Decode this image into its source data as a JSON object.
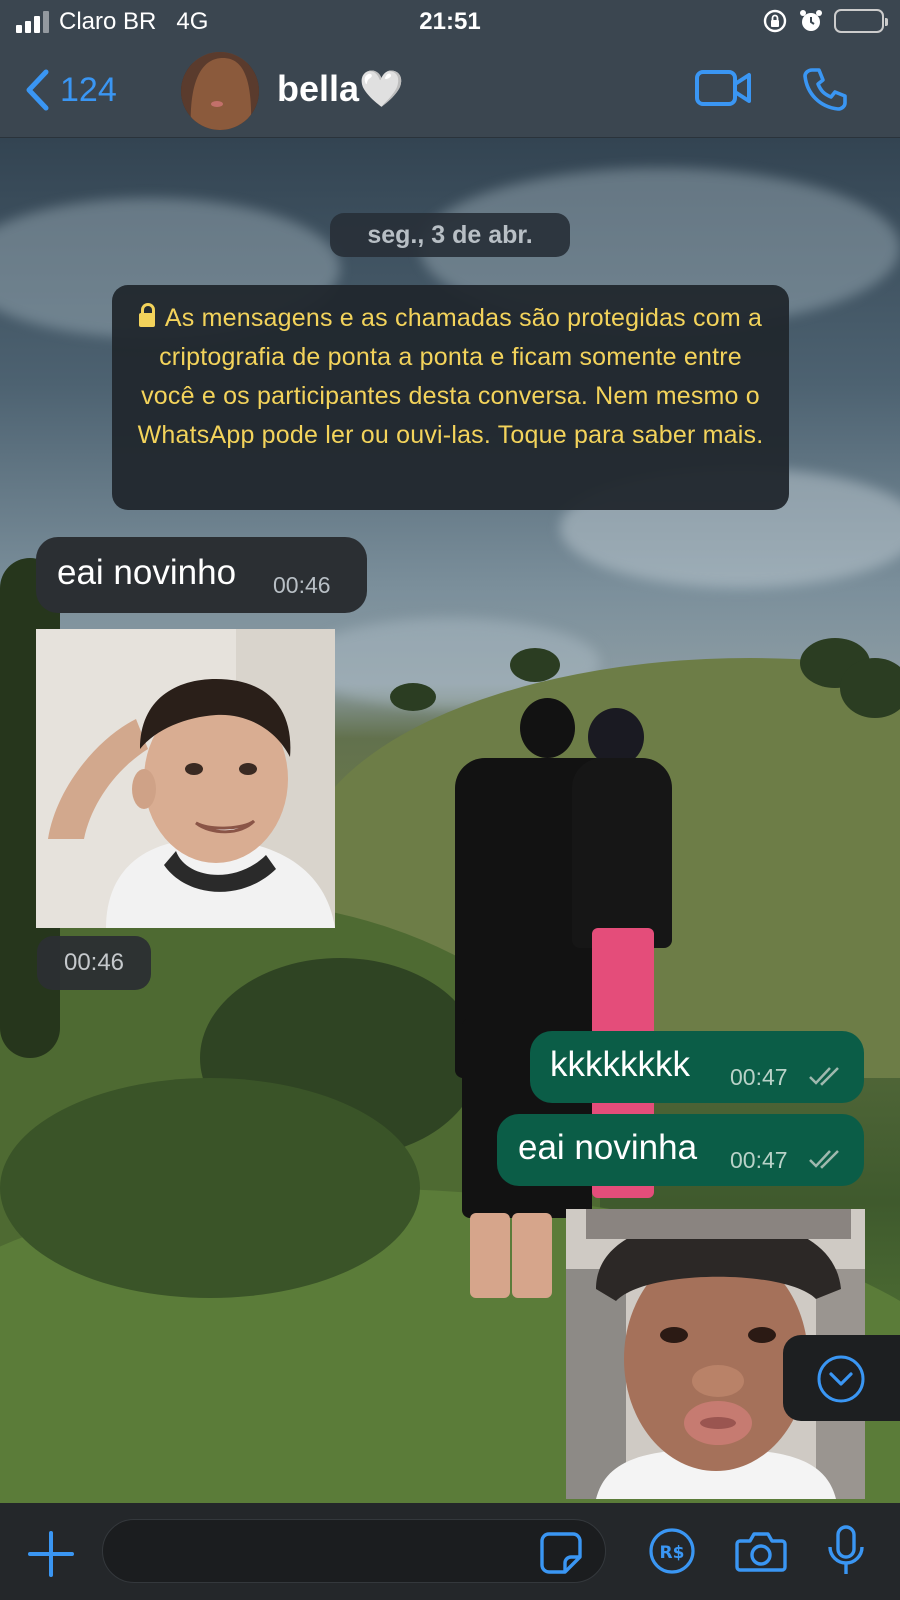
{
  "status_bar": {
    "carrier": "Claro BR",
    "network": "4G",
    "time": "21:51"
  },
  "header": {
    "back_count": "124",
    "contact_name": "bella🤍"
  },
  "chat": {
    "date_label": "seg., 3 de abr.",
    "encryption_notice": "As mensagens e as chamadas são protegidas com a criptografia de ponta a ponta e ficam somente entre você e os participantes desta conversa. Nem mesmo o WhatsApp pode ler ou ouvi-las. Toque para saber mais.",
    "messages": [
      {
        "direction": "incoming",
        "type": "text",
        "text": "eai novinho",
        "time": "00:46"
      },
      {
        "direction": "incoming",
        "type": "image",
        "time": "00:46"
      },
      {
        "direction": "outgoing",
        "type": "text",
        "text": "kkkkkkkk",
        "time": "00:47",
        "status": "read"
      },
      {
        "direction": "outgoing",
        "type": "text",
        "text": "eai novinha",
        "time": "00:47",
        "status": "read"
      },
      {
        "direction": "outgoing",
        "type": "image"
      }
    ]
  },
  "input": {
    "placeholder": ""
  },
  "icons": {
    "back": "chevron-left-icon",
    "video": "video-camera-icon",
    "call": "phone-icon",
    "attach": "plus-icon",
    "sticker": "sticker-icon",
    "payment": "payment-icon",
    "camera": "camera-icon",
    "mic": "microphone-icon",
    "scroll_down": "chevron-down-circle-icon"
  },
  "colors": {
    "accent": "#3a96f3",
    "outgoing_bubble": "#0b5d47",
    "incoming_bubble": "#2b2f33",
    "notice_text": "#f3d35b",
    "bar_bg": "#3b4650"
  }
}
